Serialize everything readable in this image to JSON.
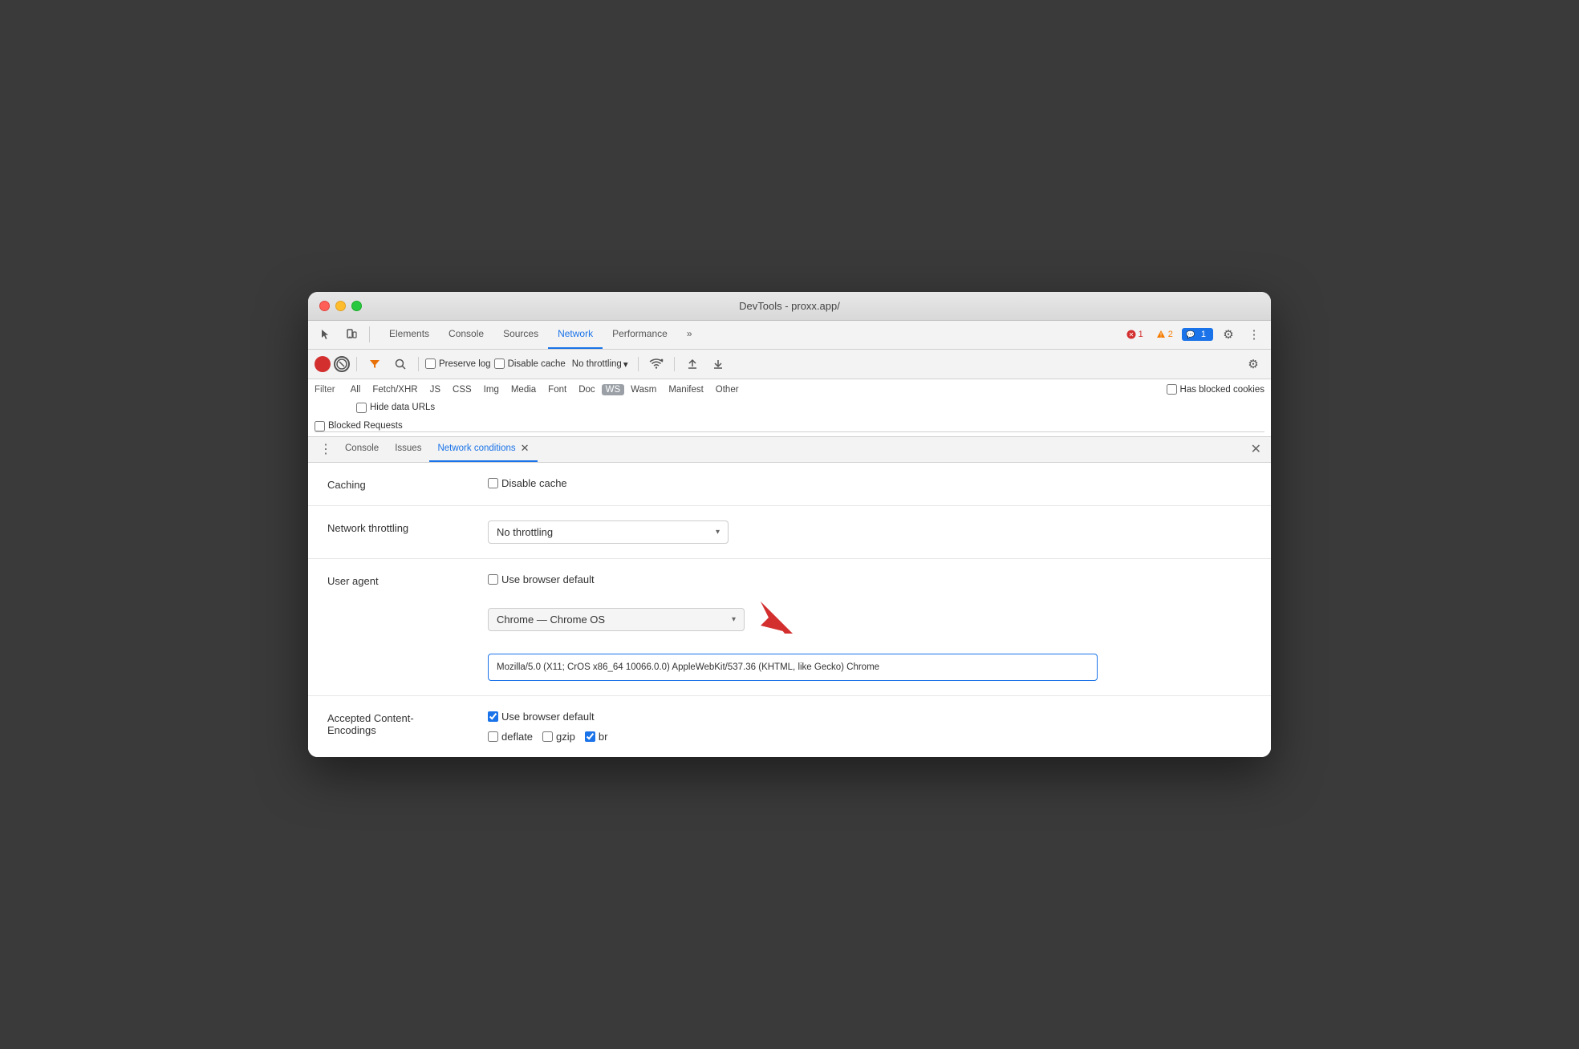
{
  "window": {
    "title": "DevTools - proxx.app/"
  },
  "titlebar": {
    "close": "●",
    "min": "●",
    "max": "●"
  },
  "topTabs": {
    "items": [
      {
        "id": "elements",
        "label": "Elements",
        "active": false
      },
      {
        "id": "console",
        "label": "Console",
        "active": false
      },
      {
        "id": "sources",
        "label": "Sources",
        "active": false
      },
      {
        "id": "network",
        "label": "Network",
        "active": true
      },
      {
        "id": "performance",
        "label": "Performance",
        "active": false
      }
    ],
    "more": "»"
  },
  "badges": {
    "error": "1",
    "warning": "2",
    "info": "1"
  },
  "networkToolbar": {
    "preserveLog": "Preserve log",
    "disableCache": "Disable cache",
    "throttling": "No throttling"
  },
  "filterBar": {
    "filterLabel": "Filter",
    "hideDataUrls": "Hide data URLs",
    "types": [
      {
        "id": "all",
        "label": "All",
        "active": false
      },
      {
        "id": "fetch",
        "label": "Fetch/XHR",
        "active": false
      },
      {
        "id": "js",
        "label": "JS",
        "active": false
      },
      {
        "id": "css",
        "label": "CSS",
        "active": false
      },
      {
        "id": "img",
        "label": "Img",
        "active": false
      },
      {
        "id": "media",
        "label": "Media",
        "active": false
      },
      {
        "id": "font",
        "label": "Font",
        "active": false
      },
      {
        "id": "doc",
        "label": "Doc",
        "active": false
      },
      {
        "id": "ws",
        "label": "WS",
        "active": false,
        "badge": true
      },
      {
        "id": "wasm",
        "label": "Wasm",
        "active": false
      },
      {
        "id": "manifest",
        "label": "Manifest",
        "active": false
      },
      {
        "id": "other",
        "label": "Other",
        "active": false
      }
    ],
    "hasBlockedCookies": "Has blocked cookies",
    "blockedRequests": "Blocked Requests"
  },
  "bottomTabs": {
    "items": [
      {
        "id": "console",
        "label": "Console",
        "active": false
      },
      {
        "id": "issues",
        "label": "Issues",
        "active": false
      },
      {
        "id": "network-conditions",
        "label": "Network conditions",
        "active": true
      }
    ]
  },
  "panelRows": {
    "caching": {
      "label": "Caching",
      "disableCacheLabel": "Disable cache"
    },
    "throttling": {
      "label": "Network throttling",
      "selectValue": "No throttling"
    },
    "userAgent": {
      "label": "User agent",
      "useBrowserDefault": "Use browser default",
      "selectedAgent": "Chrome — Chrome OS",
      "uaString": "Mozilla/5.0 (X11; CrOS x86_64 10066.0.0) AppleWebKit/537.36 (KHTML, like Gecko) Chrome"
    },
    "encodings": {
      "label": "Accepted Content-\nEncodings",
      "useBrowserDefault": "Use browser default",
      "deflate": "deflate",
      "gzip": "gzip",
      "br": "br"
    }
  }
}
